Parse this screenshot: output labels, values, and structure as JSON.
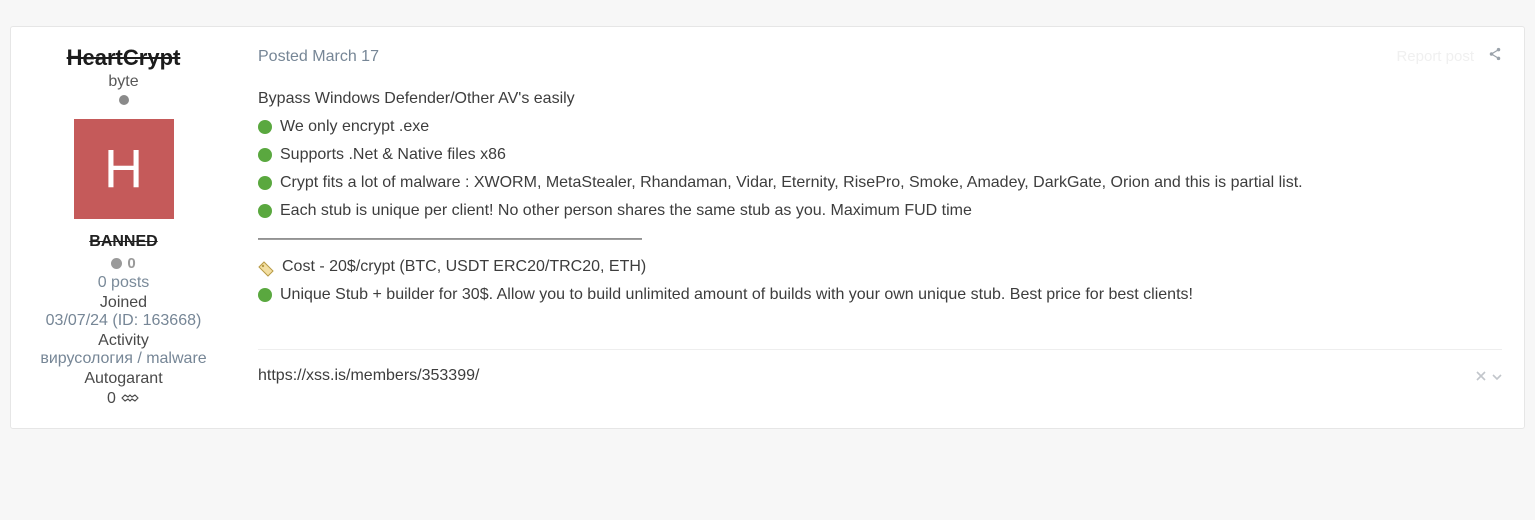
{
  "author": {
    "name": "HeartCrypt",
    "rank": "byte",
    "avatar_letter": "H",
    "status_label": "BANNED",
    "reputation": "0",
    "posts_line": "0 posts",
    "joined_label": "Joined",
    "joined_value": "03/07/24 (ID: 163668)",
    "activity_label": "Activity",
    "activity_value": "вирусология / malware",
    "autogarant_label": "Autogarant",
    "autogarant_value": "0"
  },
  "post": {
    "posted_prefix": "Posted ",
    "posted_date": "March 17",
    "report_label": "Report post",
    "intro": "Bypass Windows Defender/Other AV's easily",
    "bullets": [
      "We only encrypt .exe",
      "Supports .Net & Native files x86",
      "Crypt fits a lot of malware : XWORM, MetaStealer, Rhandaman, Vidar, Eternity, RisePro, Smoke, Amadey, DarkGate, Orion and this is partial list.",
      "Each stub is unique per client! No other person shares the same stub as you. Maximum FUD time"
    ],
    "separator": "————————————————————————",
    "cost_line": "Cost - 20$/crypt (BTC, USDT ERC20/TRC20, ETH)",
    "stub_line": "Unique Stub + builder for 30$. Allow you to build unlimited amount of builds with your own unique stub. Best price for best clients!",
    "signature_url": "https://xss.is/members/353399/"
  }
}
